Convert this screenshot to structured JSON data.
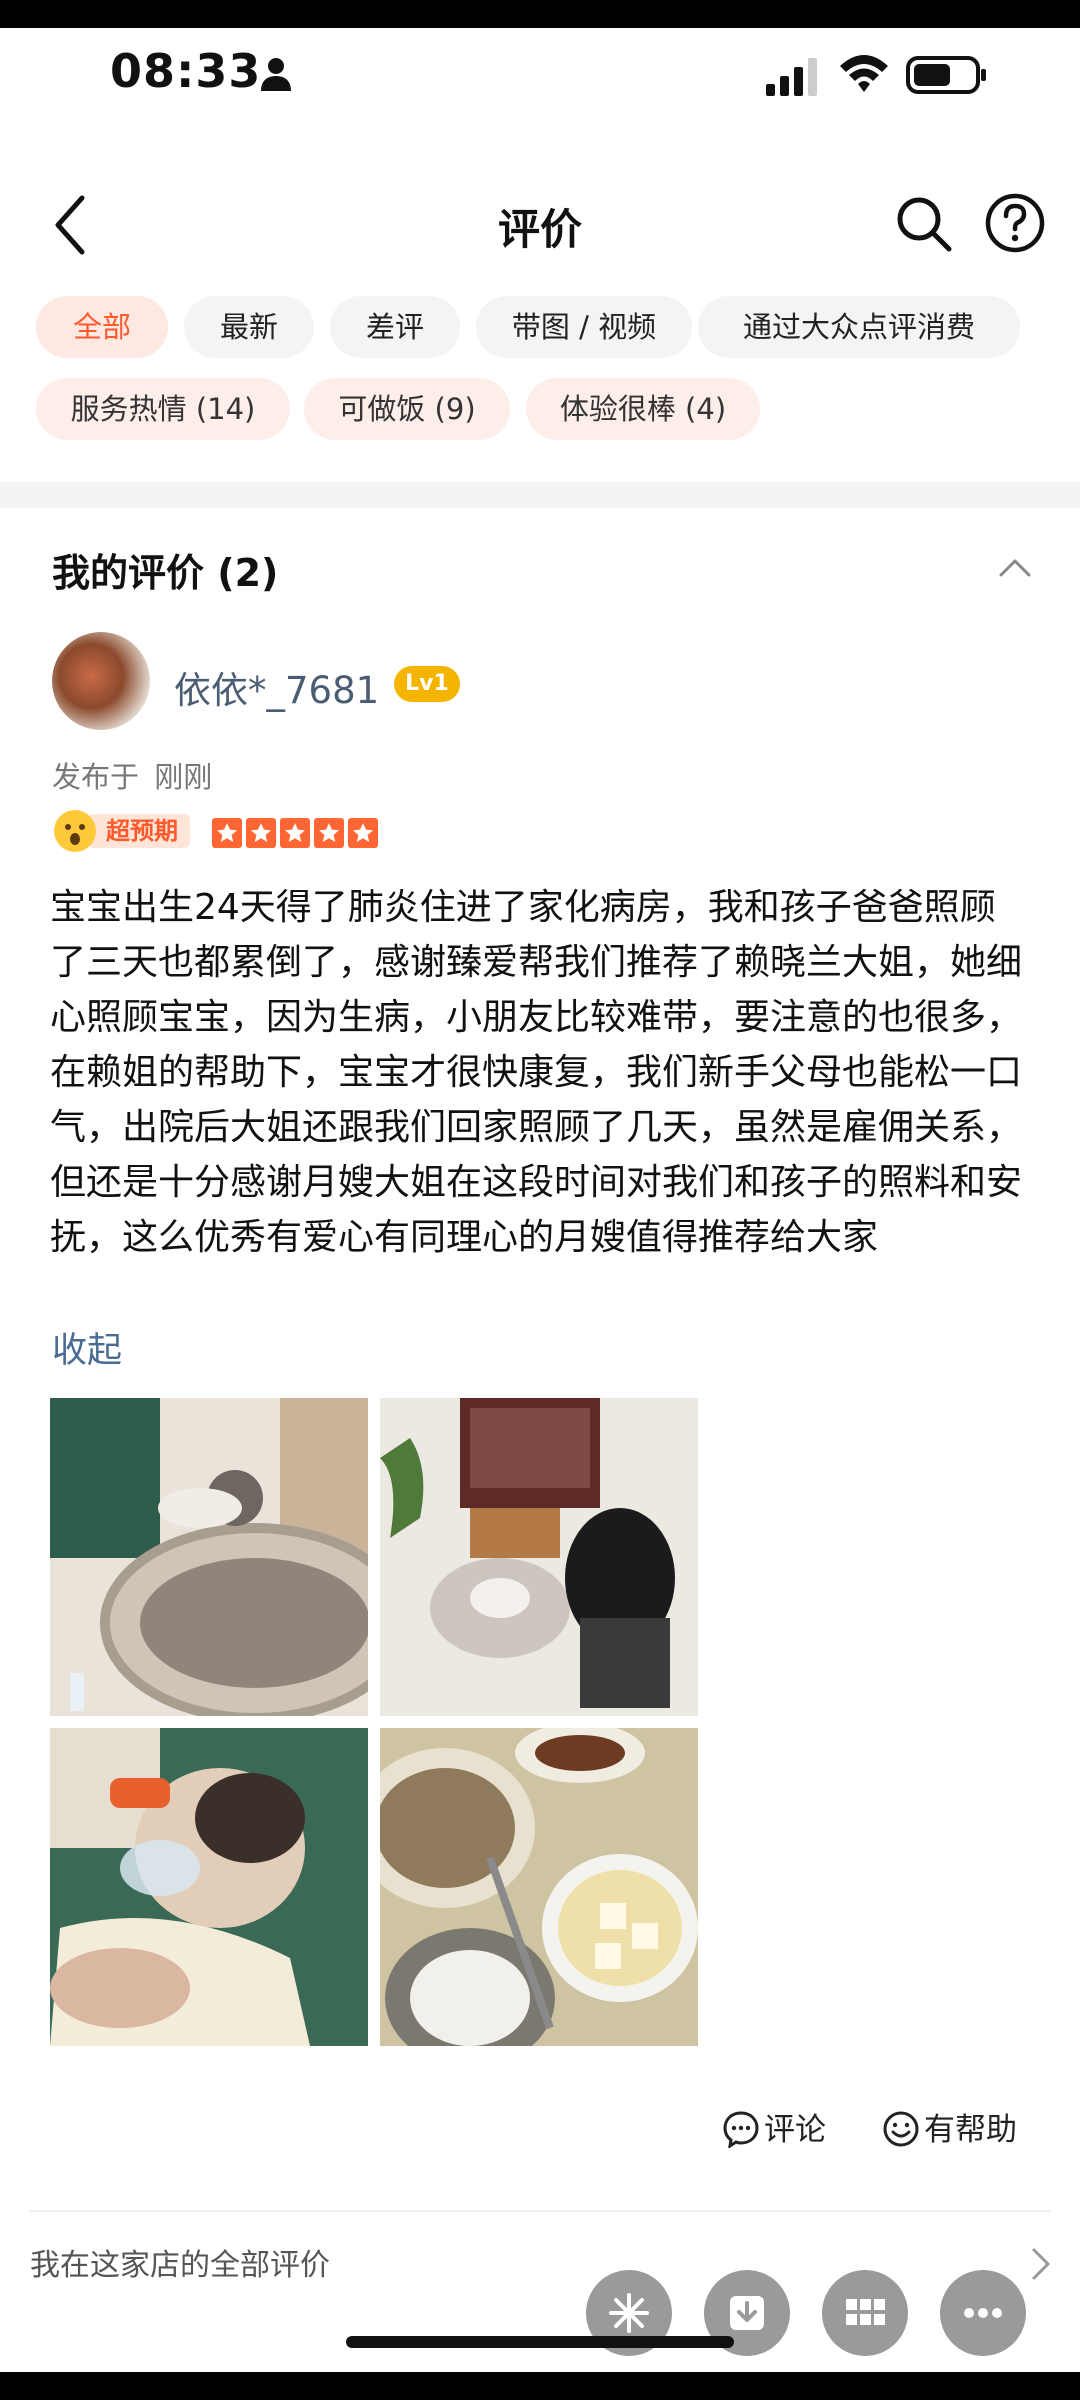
{
  "status_bar": {
    "time": "08:33"
  },
  "header": {
    "title": "评价"
  },
  "filters": {
    "all": "全部",
    "latest": "最新",
    "negative": "差评",
    "media": "带图 / 视频",
    "via_dianping": "通过大众点评消费",
    "tag1": "服务热情 (14)",
    "tag2": "可做饭 (9)",
    "tag3": "体验很棒 (4)"
  },
  "section": {
    "title": "我的评价 (2)"
  },
  "review": {
    "username": "依依*_7681",
    "level": "Lv1",
    "posted_prefix": "发布于",
    "posted_time": "刚刚",
    "exceed_label": "超预期",
    "rating": 5,
    "text": "宝宝出生24天得了肺炎住进了家化病房，我和孩子爸爸照顾了三天也都累倒了，感谢臻爱帮我们推荐了赖晓兰大姐，她细心照顾宝宝，因为生病，小朋友比较难带，要注意的也很多，在赖姐的帮助下，宝宝才很快康复，我们新手父母也能松一口气，出院后大姐还跟我们回家照顾了几天，虽然是雇佣关系，但还是十分感谢月嫂大姐在这段时间对我们和孩子的照料和安抚，这么优秀有爱心有同理心的月嫂值得推荐给大家",
    "collapse": "收起",
    "comment": "评论",
    "helpful": "有帮助"
  },
  "footer": {
    "all_reviews": "我在这家店的全部评价"
  },
  "colors": {
    "accent": "#ff5a2e",
    "link": "#4a6b93",
    "star": "#ff6633",
    "level": "#f4b400"
  },
  "icons": [
    "back-icon",
    "search-icon",
    "help-icon",
    "chevron-up-icon",
    "comment-icon",
    "smile-icon",
    "chevron-right-icon",
    "sparkle-icon",
    "download-icon",
    "grid-icon",
    "more-icon"
  ]
}
